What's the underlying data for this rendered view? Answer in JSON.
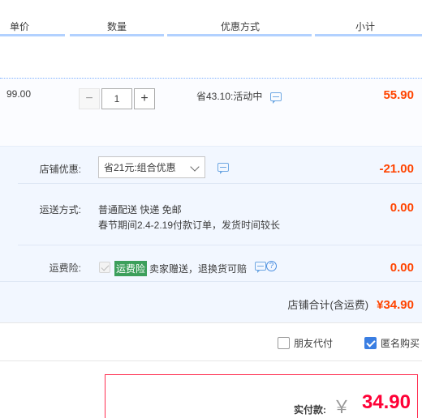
{
  "columns": {
    "unit_price": "单价",
    "quantity": "数量",
    "discount": "优惠方式",
    "subtotal": "小计"
  },
  "item": {
    "price": "99.00",
    "quantity": "1",
    "minus": "−",
    "plus": "+",
    "promo": "省43.10:活动中",
    "subtotal": "55.90"
  },
  "shop": {
    "discount_label": "店铺优惠:",
    "discount_selected": "省21元:组合优惠",
    "discount_value": "-21.00",
    "shipping_label": "运送方式:",
    "shipping_line1": "普通配送 快递 免邮",
    "shipping_line2": "春节期间2.4-2.19付款订单，发货时间较长",
    "shipping_value": "0.00",
    "insurance_label": "运费险:",
    "insurance_tag": "运费险",
    "insurance_desc": "卖家赠送，退换货可赔",
    "insurance_value": "0.00",
    "total_label": "店铺合计(含运费)",
    "total_value": "¥34.90"
  },
  "options": {
    "friend_pay": "朋友代付",
    "friend_pay_checked": false,
    "anonymous": "匿名购买",
    "anonymous_checked": true
  },
  "payment": {
    "label": "实付款:",
    "currency": "￥",
    "amount": "34.90"
  },
  "colors": {
    "accent_red": "#ff0036",
    "price_orange": "#ff4400",
    "shop_bg": "#f2f7ff",
    "header_line": "#b2d1ff",
    "check_blue": "#3a7ee2",
    "insurance_green": "#3c9f5b"
  }
}
